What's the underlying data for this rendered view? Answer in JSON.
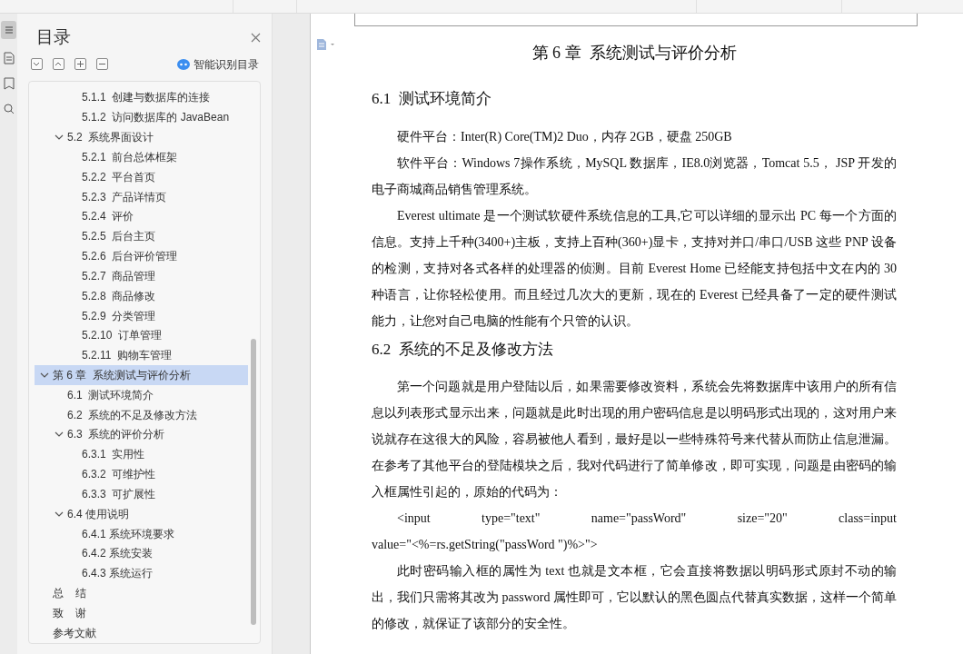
{
  "toc": {
    "title": "目录",
    "smart_label": "智能识别目录",
    "items": [
      {
        "children": [
          {
            "children": [
              {
                "label": "5.1.1  创建与数据库的连接",
                "selected": false
              },
              {
                "label": "5.1.2  访问数据库的 JavaBean",
                "selected": false
              }
            ]
          },
          {
            "label": "5.2  系统界面设计",
            "expanded": true,
            "selected": false,
            "children": [
              {
                "label": "5.2.1  前台总体框架",
                "selected": false
              },
              {
                "label": "5.2.2  平台首页",
                "selected": false
              },
              {
                "label": "5.2.3  产品详情页",
                "selected": false
              },
              {
                "label": "5.2.4  评价",
                "selected": false
              },
              {
                "label": "5.2.5  后台主页",
                "selected": false
              },
              {
                "label": "5.2.6  后台评价管理",
                "selected": false
              },
              {
                "label": "5.2.7  商品管理",
                "selected": false
              },
              {
                "label": "5.2.8  商品修改",
                "selected": false
              },
              {
                "label": "5.2.9  分类管理",
                "selected": false
              },
              {
                "label": "5.2.10  订单管理",
                "selected": false
              },
              {
                "label": "5.2.11  购物车管理",
                "selected": false
              }
            ]
          }
        ]
      },
      {
        "label": "第 6 章  系统测试与评价分析",
        "expanded": true,
        "selected": true,
        "children": [
          {
            "label": "6.1  测试环境简介",
            "selected": false
          },
          {
            "label": "6.2  系统的不足及修改方法",
            "selected": false
          },
          {
            "label": "6.3  系统的评价分析",
            "expanded": true,
            "selected": false,
            "children": [
              {
                "label": "6.3.1  实用性",
                "selected": false
              },
              {
                "label": "6.3.2  可维护性",
                "selected": false
              },
              {
                "label": "6.3.3  可扩展性",
                "selected": false
              }
            ]
          },
          {
            "label": "6.4 使用说明",
            "expanded": true,
            "selected": false,
            "children": [
              {
                "label": "6.4.1 系统环境要求",
                "selected": false
              },
              {
                "label": "6.4.2 系统安装",
                "selected": false
              },
              {
                "label": "6.4.3 系统运行",
                "selected": false
              }
            ]
          }
        ]
      },
      {
        "label": "总    结",
        "selected": false
      },
      {
        "label": "致    谢",
        "selected": false
      },
      {
        "label": "参考文献",
        "selected": false
      }
    ]
  },
  "document": {
    "blocks": [
      {
        "kind": "title",
        "text": "第 6 章  系统测试与评价分析"
      },
      {
        "kind": "heading",
        "text": "6.1  测试环境简介"
      },
      {
        "kind": "paragraph",
        "text": "硬件平台：Inter(R) Core(TM)2 Duo，内存 2GB，硬盘 250GB"
      },
      {
        "kind": "paragraph",
        "text": "软件平台：Windows 7操作系统，MySQL 数据库，IE8.0浏览器，Tomcat 5.5， JSP 开发的电子商城商品销售管理系统。"
      },
      {
        "kind": "paragraph",
        "text": "Everest ultimate 是一个测试软硬件系统信息的工具,它可以详细的显示出 PC 每一个方面的信息。支持上千种(3400+)主板，支持上百种(360+)显卡，支持对并口/串口/USB 这些 PNP 设备的检测，支持对各式各样的处理器的侦测。目前 Everest Home 已经能支持包括中文在内的 30 种语言，让你轻松使用。而且经过几次大的更新，现在的 Everest 已经具备了一定的硬件测试能力，让您对自己电脑的性能有个只管的认识。"
      },
      {
        "kind": "heading",
        "text": "6.2  系统的不足及修改方法"
      },
      {
        "kind": "paragraph",
        "text": "第一个问题就是用户登陆以后，如果需要修改资料，系统会先将数据库中该用户的所有信息以列表形式显示出来，问题就是此时出现的用户密码信息是以明码形式出现的，这对用户来说就存在这很大的风险，容易被他人看到，最好是以一些特殊符号来代替从而防止信息泄漏。在参考了其他平台的登陆模块之后，我对代码进行了简单修改，即可实现，问题是由密码的输入框属性引起的，原始的代码为："
      },
      {
        "kind": "code",
        "tokens": [
          "<input",
          "type=\"text\"",
          "name=\"passWord\"",
          "size=\"20\"",
          "class=input"
        ],
        "continuation": "value=\"<%=rs.getString(\"passWord \")%>\">"
      },
      {
        "kind": "paragraph",
        "text": "此时密码输入框的属性为 text 也就是文本框，它会直接将数据以明码形式原封不动的输出，我们只需将其改为 password 属性即可，它以默认的黑色圆点代替真实数据，这样一个简单的修改，就保证了该部分的安全性。"
      }
    ]
  }
}
